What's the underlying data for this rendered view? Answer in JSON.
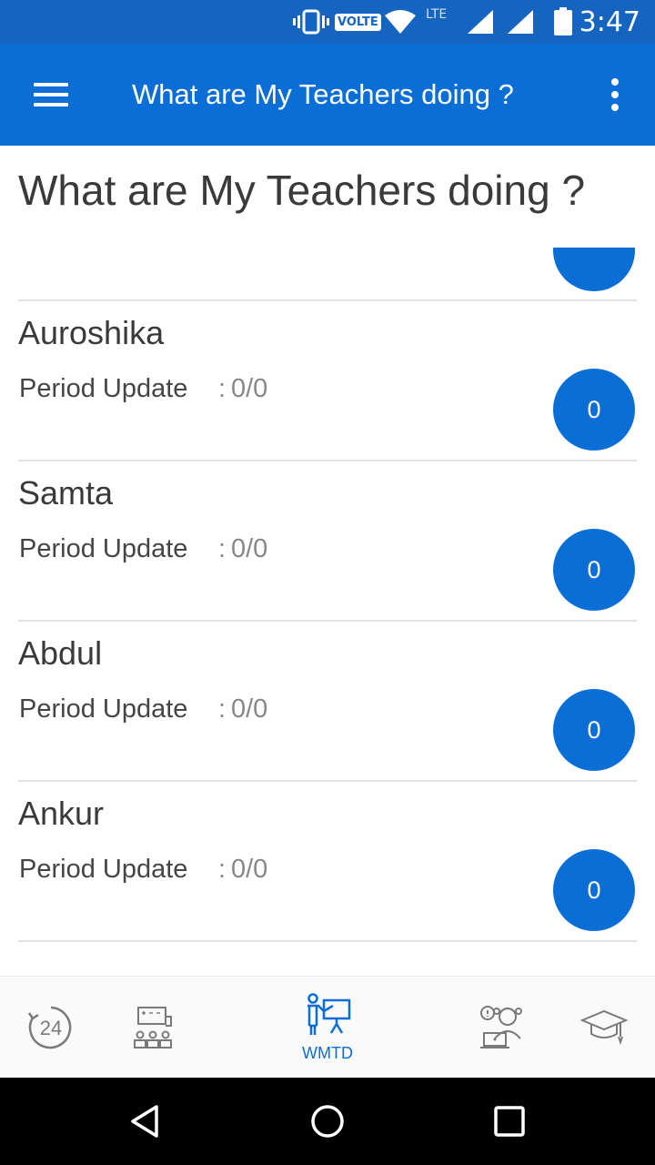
{
  "status_bar": {
    "volte_label": "VOLTE",
    "lte_label": "LTE",
    "time": "3:47"
  },
  "app_bar": {
    "title": "What are My Teachers doing ?"
  },
  "page": {
    "title": "What are My Teachers doing ?"
  },
  "teachers": [
    {
      "name": "Auroshika",
      "period_label": "Period Update",
      "period_sep": ":",
      "period_value": "0/0",
      "count": "0"
    },
    {
      "name": "Samta",
      "period_label": "Period Update",
      "period_sep": ":",
      "period_value": "0/0",
      "count": "0"
    },
    {
      "name": "Abdul",
      "period_label": "Period Update",
      "period_sep": ":",
      "period_value": "0/0",
      "count": "0"
    },
    {
      "name": "Ankur",
      "period_label": "Period Update",
      "period_sep": ":",
      "period_value": "0/0",
      "count": "0"
    }
  ],
  "bottom_nav": {
    "items": [
      {
        "icon": "24-hours-icon",
        "label": ""
      },
      {
        "icon": "classroom-icon",
        "label": ""
      },
      {
        "icon": "teacher-board-icon",
        "label": "WMTD",
        "active": true
      },
      {
        "icon": "student-laptop-icon",
        "label": ""
      },
      {
        "icon": "graduation-cap-icon",
        "label": ""
      }
    ],
    "hours_label": "24",
    "active_color": "#0a6ed6",
    "inactive_color": "#7a7a7a"
  },
  "colors": {
    "primary": "#0a6ed6",
    "status_bar": "#1565c0"
  }
}
